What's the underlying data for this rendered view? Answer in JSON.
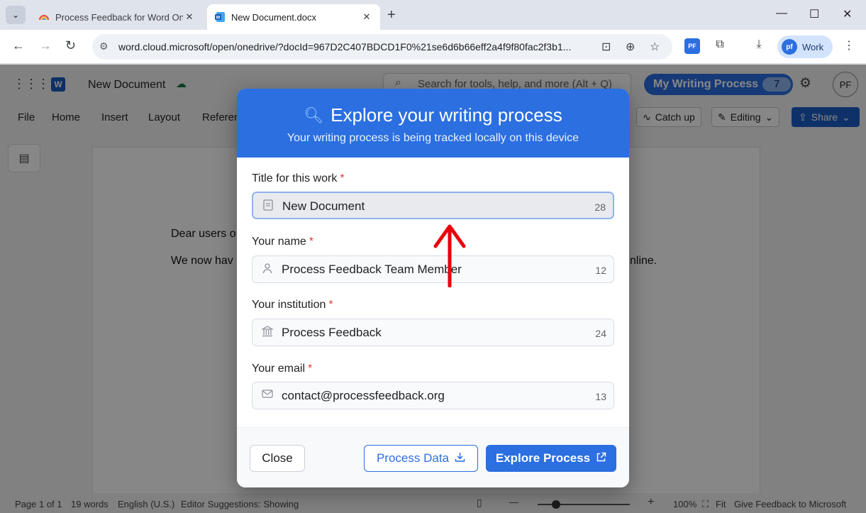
{
  "browser": {
    "tabs": [
      {
        "title": "Process Feedback for Word Onl",
        "active": false
      },
      {
        "title": "New Document.docx",
        "active": true
      }
    ],
    "url": "word.cloud.microsoft/open/onedrive/?docId=967D2C407BDCD1F0%21se6d6b66eff2a4f9f80fac2f3b1...",
    "profile_label": "Work",
    "profile_initials": "pf",
    "ext_badge": "PF"
  },
  "word": {
    "doc_name": "New Document",
    "search_placeholder": "Search for tools, help, and more (Alt + Q)",
    "my_writing_process": {
      "label": "My Writing Process",
      "count": "7"
    },
    "avatar_initials": "PF",
    "ribbon_tabs": [
      "File",
      "Home",
      "Insert",
      "Layout",
      "Referen"
    ],
    "catch_up": "Catch up",
    "editing": "Editing",
    "share": "Share",
    "document": {
      "para1": "Dear users o",
      "para2_left": "We now hav",
      "para2_right": "nline."
    },
    "status": {
      "page": "Page 1 of 1",
      "words": "19 words",
      "language": "English (U.S.)",
      "editor": "Editor Suggestions: Showing",
      "zoom_minus": "—",
      "zoom_plus": "+",
      "zoom": "100%",
      "fit": "Fit",
      "feedback": "Give Feedback to Microsoft",
      "zoom_level": 0.2
    }
  },
  "modal": {
    "title": "Explore your writing process",
    "subtitle": "Your writing process is being tracked locally on this device",
    "fields": [
      {
        "label": "Title for this work",
        "required_mark": "*",
        "value": "New Document",
        "count": "28",
        "icon": "document-icon"
      },
      {
        "label": "Your name",
        "required_mark": "*",
        "value": "Process Feedback Team Member",
        "count": "12",
        "icon": "person-icon"
      },
      {
        "label": "Your institution",
        "required_mark": "*",
        "value": "Process Feedback",
        "count": "24",
        "icon": "institution-icon"
      },
      {
        "label": "Your email",
        "required_mark": "*",
        "value": "contact@processfeedback.org",
        "count": "13",
        "icon": "mail-icon"
      }
    ],
    "buttons": {
      "close": "Close",
      "process_data": "Process Data",
      "explore_process": "Explore Process"
    }
  },
  "colors": {
    "accent": "#2b6fe0",
    "required": "#e53935",
    "annotation_arrow": "#e8000b"
  }
}
